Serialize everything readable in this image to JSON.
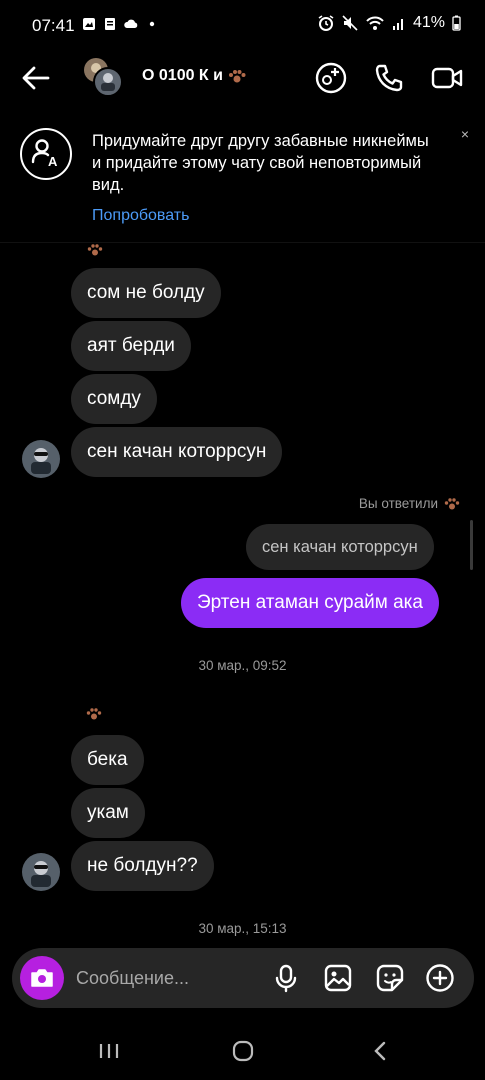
{
  "status_bar": {
    "time": "07:41",
    "battery": "41%"
  },
  "header": {
    "title": "О 0100 К и"
  },
  "nickname_banner": {
    "text": "Придумайте друг другу забавные никнеймы и придайте этому чату свой неповторимый вид.",
    "link": "Попробовать",
    "close": "×"
  },
  "messages": {
    "m1": "сом не болду",
    "m2": "аят берди",
    "m3": "сомду",
    "m4": "сен качан которрсун",
    "reply_label": "Вы ответили",
    "reply_quote": "сен качан которрсун",
    "m5": "Эртен атаман сурайм ака",
    "ts1": "30 мар., 09:52",
    "m6": "бека",
    "m7": "укам",
    "m8": "не болдун??",
    "ts2": "30 мар., 15:13"
  },
  "composer": {
    "placeholder": "Сообщение..."
  },
  "colors": {
    "accent_purple": "#8b2cf5",
    "camera_button": "#b620e0",
    "link_blue": "#4c9bf7",
    "incoming_bubble": "#262626",
    "background": "#000000"
  },
  "icons": [
    "back-arrow-icon",
    "group-avatar-icon",
    "paw-emoji-icon",
    "add-people-icon",
    "phone-icon",
    "video-camera-icon",
    "nickname-icon",
    "camera-icon",
    "microphone-icon",
    "gallery-icon",
    "sticker-icon",
    "plus-icon",
    "recent-apps-icon",
    "home-icon",
    "nav-back-icon"
  ]
}
